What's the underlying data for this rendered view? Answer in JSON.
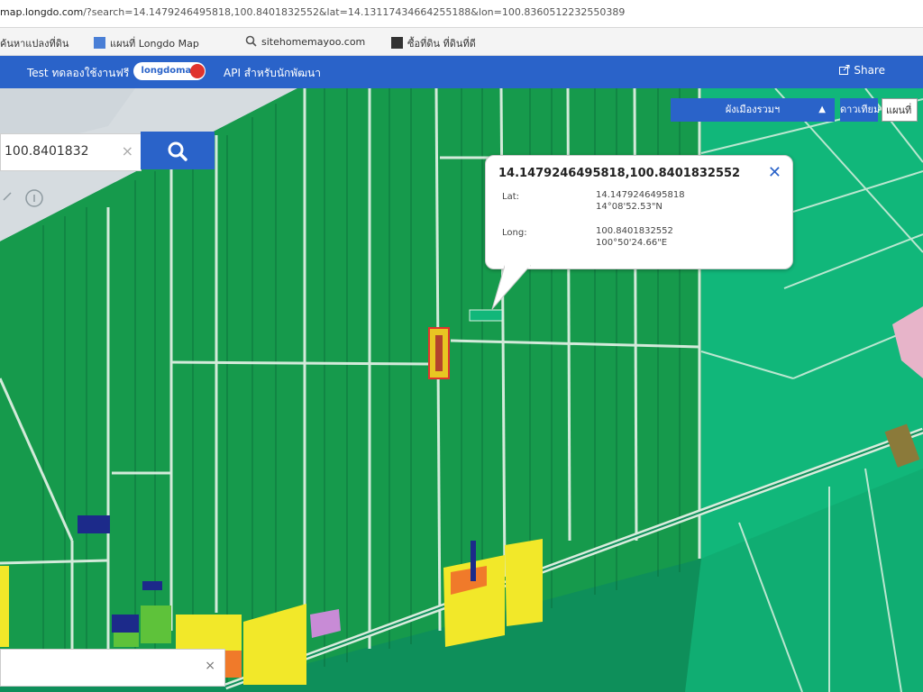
{
  "browser": {
    "url_domain": "map.longdo.com",
    "url_rest": "/?search=14.1479246495818,100.8401832552&lat=14.13117434664255188&lon=100.8360512232550389",
    "bookmarks": [
      {
        "label": "ค้นหาแปลงที่ดิน",
        "icon": "bookmark-icon"
      },
      {
        "label": "แผนที่ Longdo Map",
        "icon": "map-icon"
      },
      {
        "label": "sitehomemayoo.com",
        "icon": "search-icon"
      },
      {
        "label": "ซื้อที่ดิน ที่ดินที่ดี",
        "icon": "page-icon"
      }
    ]
  },
  "header": {
    "tabs": [
      "Test ทดลองใช้งานฟรี",
      "API สำหรับนักพัฒนา"
    ],
    "badge": "longdomap",
    "share": "Share"
  },
  "search": {
    "value": "100.8401832",
    "clear": "×"
  },
  "layer_control": {
    "select_label": "ผังเมืองรวมฯ",
    "arrow": "▲",
    "blue_label": "ดาวเทียม",
    "white_label": "แผนที่"
  },
  "popup": {
    "title": "14.1479246495818,100.8401832552",
    "close": "✕",
    "lat_label": "Lat:",
    "lat_dec": "14.1479246495818",
    "lat_dms": "14°08'52.53\"N",
    "long_label": "Long:",
    "long_dec": "100.8401832552",
    "long_dms": "100°50'24.66\"E"
  },
  "bottom_panel": {
    "close": "×"
  },
  "colors": {
    "brand_blue": "#2a63c9",
    "zone_green": "#0e8f5a",
    "zone_light_green": "#0fb874",
    "zone_yellow": "#f2e829",
    "zone_purple": "#c88bd6",
    "zone_navy": "#1c2a8a",
    "zone_orange": "#f07a2a"
  }
}
